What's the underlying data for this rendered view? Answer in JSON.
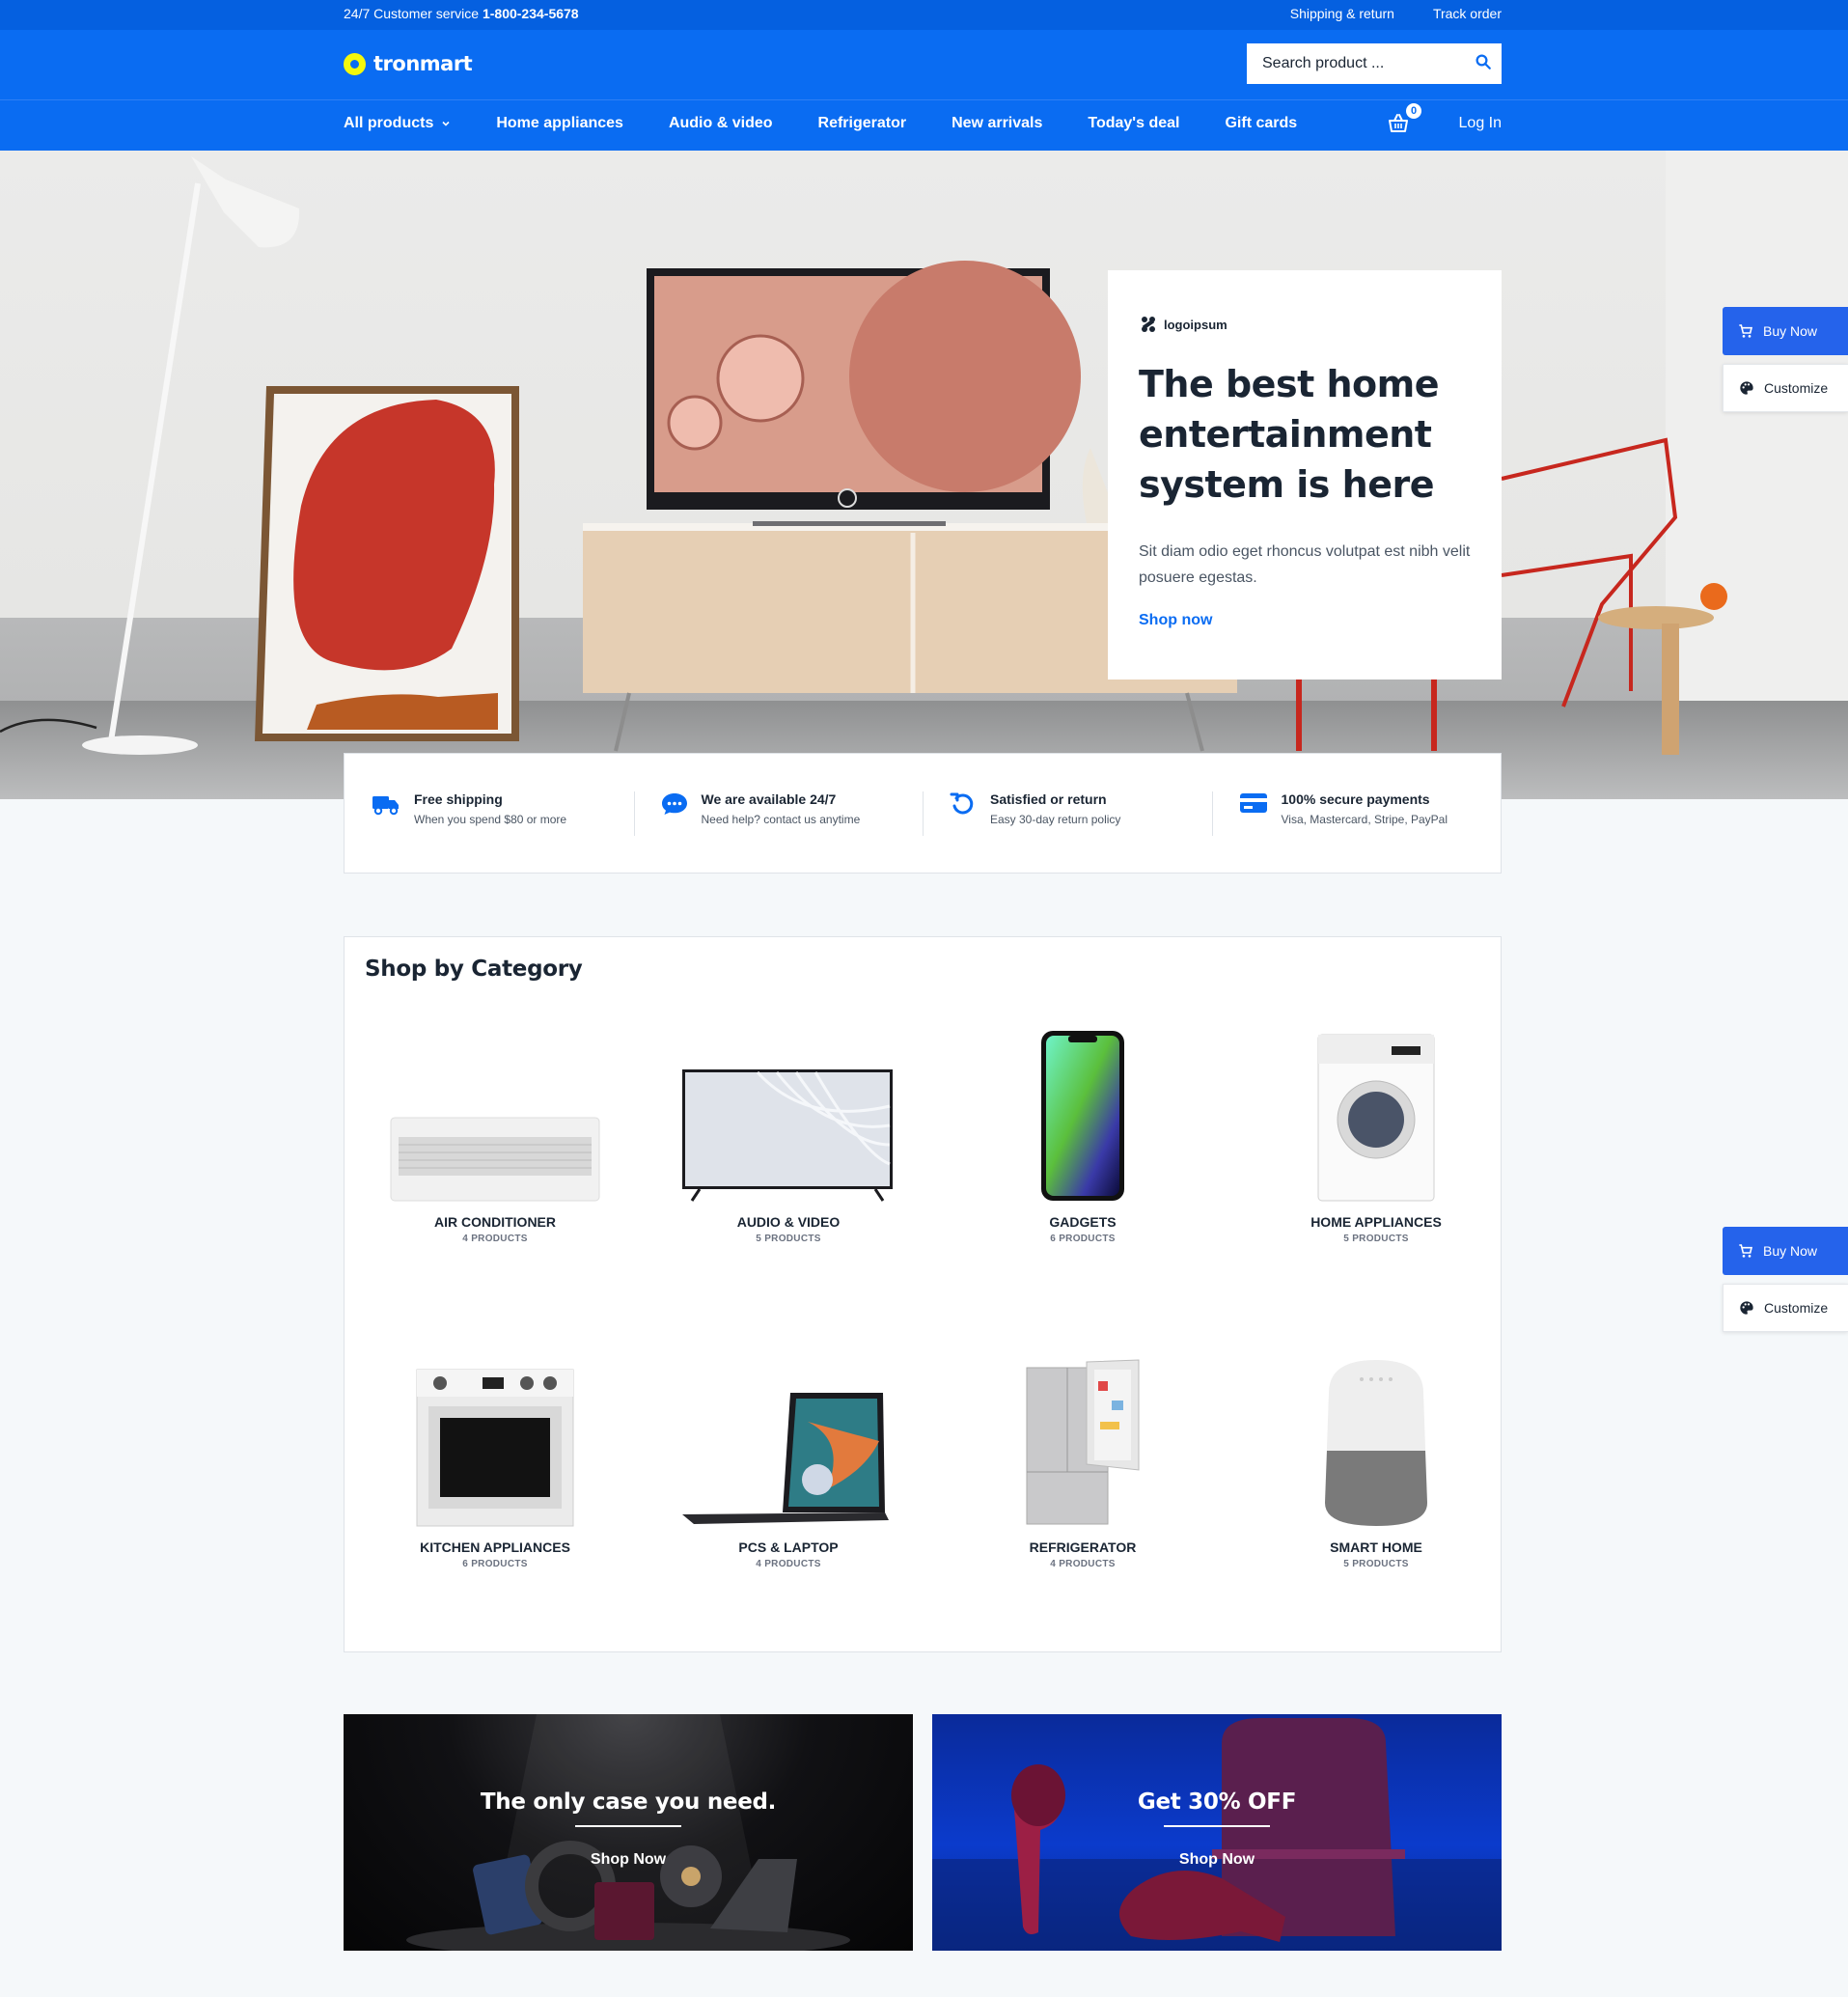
{
  "topbar": {
    "service_label": "24/7 Customer service",
    "phone": "1-800-234-5678",
    "links": [
      "Shipping & return",
      "Track order"
    ]
  },
  "header": {
    "logo_text": "tronmart",
    "search_placeholder": "Search product ...",
    "nav": [
      "All products",
      "Home appliances",
      "Audio & video",
      "Refrigerator",
      "New arrivals",
      "Today's deal",
      "Gift cards"
    ],
    "cart_count": "0",
    "login": "Log In"
  },
  "hero": {
    "brand": "logoipsum",
    "title": "The best home entertainment system is here",
    "text": "Sit diam odio eget rhoncus volutpat est nibh velit posuere egestas.",
    "cta": "Shop now"
  },
  "side_buttons": {
    "buy": "Buy Now",
    "customize": "Customize"
  },
  "features": [
    {
      "title": "Free shipping",
      "sub": "When you spend $80 or more",
      "icon": "truck-icon"
    },
    {
      "title": "We are available 24/7",
      "sub": "Need help? contact us anytime",
      "icon": "chat-icon"
    },
    {
      "title": "Satisfied or return",
      "sub": "Easy 30-day return policy",
      "icon": "return-icon"
    },
    {
      "title": "100% secure payments",
      "sub": "Visa, Mastercard, Stripe, PayPal",
      "icon": "credit-card-icon"
    }
  ],
  "categories": {
    "title": "Shop by Category",
    "items": [
      {
        "name": "AIR CONDITIONER",
        "count": "4 PRODUCTS"
      },
      {
        "name": "AUDIO & VIDEO",
        "count": "5 PRODUCTS"
      },
      {
        "name": "GADGETS",
        "count": "6 PRODUCTS"
      },
      {
        "name": "HOME APPLIANCES",
        "count": "5 PRODUCTS"
      },
      {
        "name": "KITCHEN APPLIANCES",
        "count": "6 PRODUCTS"
      },
      {
        "name": "PCS & LAPTOP",
        "count": "4 PRODUCTS"
      },
      {
        "name": "REFRIGERATOR",
        "count": "4 PRODUCTS"
      },
      {
        "name": "SMART HOME",
        "count": "5 PRODUCTS"
      }
    ]
  },
  "banners": [
    {
      "headline": "The only case you need.",
      "cta": "Shop Now"
    },
    {
      "headline": "Get 30% OFF",
      "cta": "Shop Now"
    }
  ],
  "colors": {
    "primary": "#0a6cf2",
    "topbar": "#0560e0",
    "logo_accent": "#f4f80c",
    "buy_button": "#2563eb"
  }
}
